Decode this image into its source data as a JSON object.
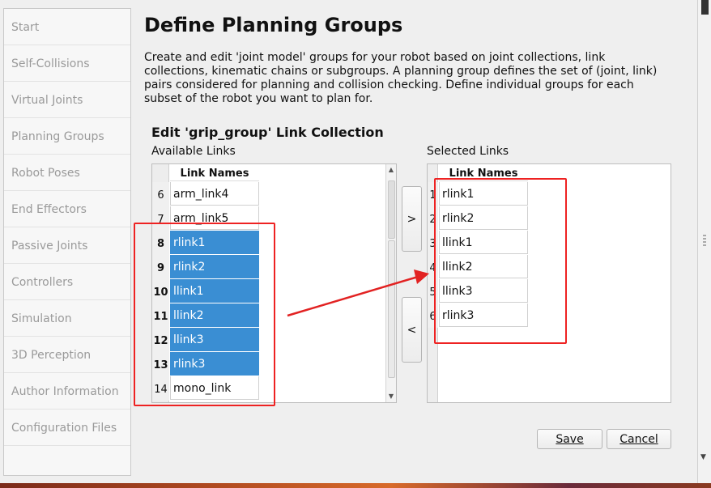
{
  "sidebar": {
    "items": [
      {
        "label": "Start"
      },
      {
        "label": "Self-Collisions"
      },
      {
        "label": "Virtual Joints"
      },
      {
        "label": "Planning Groups"
      },
      {
        "label": "Robot Poses"
      },
      {
        "label": "End Effectors"
      },
      {
        "label": "Passive Joints"
      },
      {
        "label": "Controllers"
      },
      {
        "label": "Simulation"
      },
      {
        "label": "3D Perception"
      },
      {
        "label": "Author Information"
      },
      {
        "label": "Configuration Files"
      }
    ]
  },
  "main": {
    "title": "Define Planning Groups",
    "description": "Create and edit 'joint model' groups for your robot based on joint collections, link collections, kinematic chains or subgroups. A planning group defines the set of (joint, link) pairs considered for planning and collision checking. Define individual groups for each subset of the robot you want to plan for.",
    "subtitle": "Edit 'grip_group' Link Collection",
    "available_label": "Available Links",
    "selected_label": "Selected Links",
    "column_header": "Link Names",
    "available_rows": [
      {
        "num": "6",
        "name": "arm_link4",
        "selected": false
      },
      {
        "num": "7",
        "name": "arm_link5",
        "selected": false
      },
      {
        "num": "8",
        "name": "rlink1",
        "selected": true
      },
      {
        "num": "9",
        "name": "rlink2",
        "selected": true
      },
      {
        "num": "10",
        "name": "llink1",
        "selected": true
      },
      {
        "num": "11",
        "name": "llink2",
        "selected": true
      },
      {
        "num": "12",
        "name": "llink3",
        "selected": true
      },
      {
        "num": "13",
        "name": "rlink3",
        "selected": true
      },
      {
        "num": "14",
        "name": "mono_link",
        "selected": false
      }
    ],
    "selected_rows": [
      {
        "num": "1",
        "name": "rlink1"
      },
      {
        "num": "2",
        "name": "rlink2"
      },
      {
        "num": "3",
        "name": "llink1"
      },
      {
        "num": "4",
        "name": "llink2"
      },
      {
        "num": "5",
        "name": "llink3"
      },
      {
        "num": "6",
        "name": "rlink3"
      }
    ],
    "add_button": ">",
    "remove_button": "<",
    "save_button": "Save",
    "cancel_button": "Cancel"
  },
  "colors": {
    "selection": "#3a8ed3",
    "annotation": "#e22222"
  }
}
